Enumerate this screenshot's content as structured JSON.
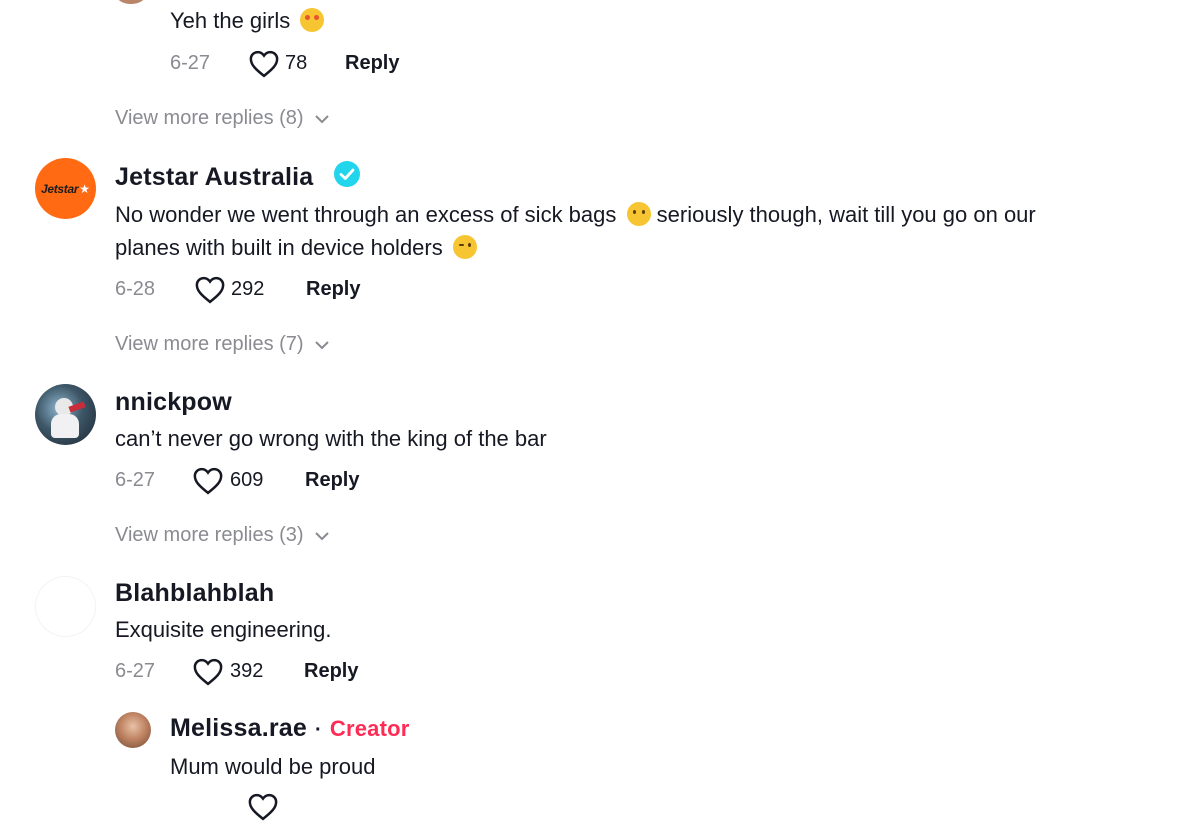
{
  "comments": [
    {
      "text": "Yeh the girls",
      "date": "6-27",
      "likes": "78",
      "reply_label": "Reply",
      "view_more": "View more replies (8)"
    },
    {
      "username": "Jetstar Australia",
      "avatar_text": "Jetstar",
      "verified": true,
      "text_line1": "No wonder we went through an excess of sick bags",
      "text_line1b": "seriously though, wait till you go on our",
      "text_line2": "planes with built in device holders",
      "date": "6-28",
      "likes": "292",
      "reply_label": "Reply",
      "view_more": "View more replies (7)"
    },
    {
      "username": "nnickpow",
      "text": "can’t never go wrong with the king of the bar",
      "date": "6-27",
      "likes": "609",
      "reply_label": "Reply",
      "view_more": "View more replies (3)"
    },
    {
      "username": "Blahblahblah",
      "text": "Exquisite engineering.",
      "date": "6-27",
      "likes": "392",
      "reply_label": "Reply"
    }
  ],
  "reply": {
    "username": "Melissa.rae",
    "separator": "·",
    "badge": "Creator",
    "text": "Mum would be proud"
  },
  "colors": {
    "accent_creator": "#fe2c55",
    "verified": "#20d5ec",
    "jetstar_orange": "#ff6a13",
    "muted": "#8a8b91"
  }
}
